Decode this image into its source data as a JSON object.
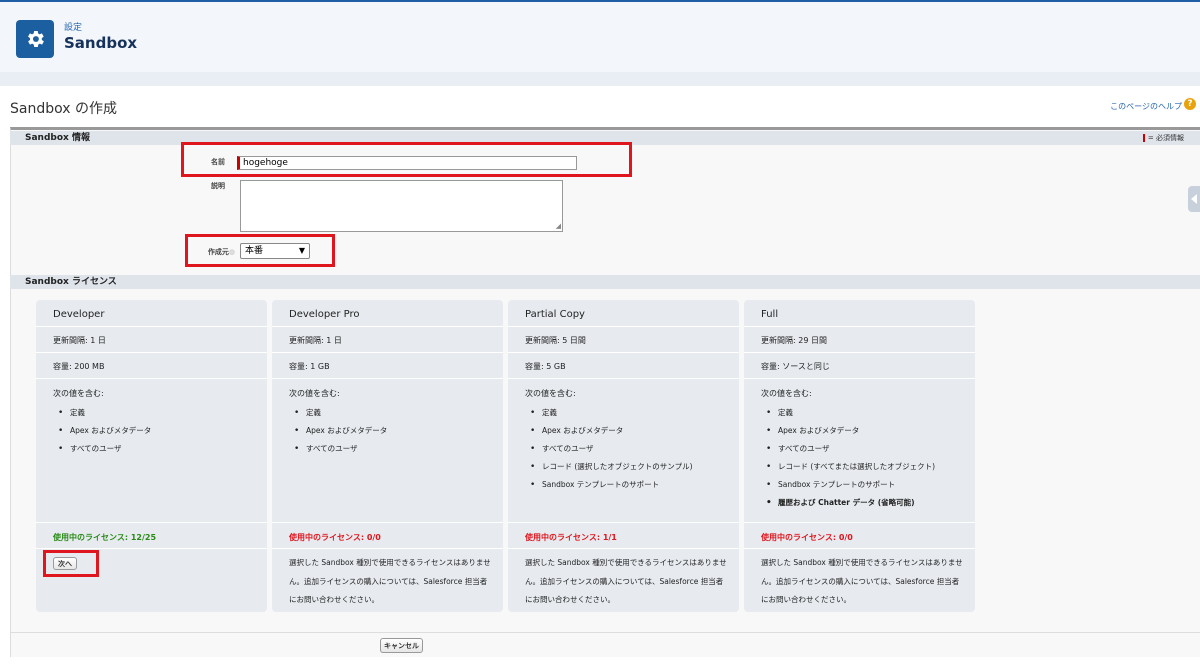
{
  "header": {
    "breadcrumb": "設定",
    "title": "Sandbox",
    "icon": "gear-icon"
  },
  "page": {
    "title": "Sandbox の作成",
    "help_link": "このページのヘルプ",
    "help_icon": "?"
  },
  "info_section": {
    "title": "Sandbox 情報",
    "required_legend": "= 必須情報",
    "name_label": "名前",
    "name_value": "hogehoge",
    "description_label": "説明",
    "create_from_label": "作成元",
    "create_from_value": "本番"
  },
  "license_section": {
    "title": "Sandbox ライセンス"
  },
  "cards": [
    {
      "name": "Developer",
      "refresh": "更新間隔: 1 日",
      "storage": "容量: 200 MB",
      "includes_label": "次の値を含む:",
      "items": [
        "定義",
        "Apex およびメタデータ",
        "すべてのユーザ"
      ],
      "licenses": "使用中のライセンス: 12/25",
      "button": "次へ"
    },
    {
      "name": "Developer Pro",
      "refresh": "更新間隔: 1 日",
      "storage": "容量: 1 GB",
      "includes_label": "次の値を含む:",
      "items": [
        "定義",
        "Apex およびメタデータ",
        "すべてのユーザ"
      ],
      "licenses": "使用中のライセンス: 0/0",
      "message": "選択した Sandbox 種別で使用できるライセンスはありません。追加ライセンスの購入については、Salesforce 担当者にお問い合わせください。"
    },
    {
      "name": "Partial Copy",
      "refresh": "更新間隔: 5 日間",
      "storage": "容量: 5 GB",
      "includes_label": "次の値を含む:",
      "items": [
        "定義",
        "Apex およびメタデータ",
        "すべてのユーザ",
        "レコード (選択したオブジェクトのサンプル)",
        "Sandbox テンプレートのサポート"
      ],
      "licenses": "使用中のライセンス: 1/1",
      "message": "選択した Sandbox 種別で使用できるライセンスはありません。追加ライセンスの購入については、Salesforce 担当者にお問い合わせください。"
    },
    {
      "name": "Full",
      "refresh": "更新間隔: 29 日間",
      "storage": "容量: ソースと同じ",
      "includes_label": "次の値を含む:",
      "items": [
        "定義",
        "Apex およびメタデータ",
        "すべてのユーザ",
        "レコード (すべてまたは選択したオブジェクト)",
        "Sandbox テンプレートのサポート",
        "履歴および Chatter データ (省略可能)"
      ],
      "licenses": "使用中のライセンス: 0/0",
      "message": "選択した Sandbox 種別で使用できるライセンスはありません。追加ライセンスの購入については、Salesforce 担当者にお問い合わせください。"
    }
  ],
  "footer": {
    "cancel_label": "キャンセル"
  },
  "colors": {
    "accent": "#1b5fa0",
    "highlight": "#e0161e",
    "license_ok": "#2a8a16",
    "license_none": "#e0161e"
  }
}
